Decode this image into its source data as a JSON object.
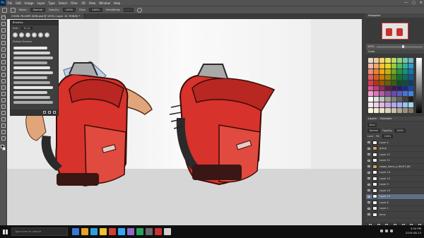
{
  "app": {
    "logo": "Ps",
    "menus": [
      "File",
      "Edit",
      "Image",
      "Layer",
      "Type",
      "Select",
      "Filter",
      "3D",
      "View",
      "Window",
      "Help"
    ],
    "window_controls": [
      "—",
      "▢",
      "✕"
    ]
  },
  "options_bar": {
    "mode_label": "Mode:",
    "mode_value": "Normal",
    "opacity_label": "Opacity:",
    "opacity_value": "100%",
    "flow_label": "Flow:",
    "flow_value": "100%",
    "smoothing_label": "Smoothing:"
  },
  "document_tab": {
    "title": "CHARL PALMER (WIN.psd @ 100% (Layer 10, RGB/8) *"
  },
  "brush_panel": {
    "title": "Brushes",
    "size_label": "Size:",
    "size_value": "10 px",
    "group_label": "Default Brushes",
    "stroke_count": 12
  },
  "right_panels": {
    "navigator_tab": "Navigator",
    "zoom_value": "100%",
    "color_tab": "Color",
    "layers_tab": "Layers",
    "channels_tab": "Channels",
    "kind_label": "Kind",
    "blend_mode": "Normal",
    "opacity_label": "Opacity:",
    "opacity_value": "100%",
    "lock_label": "Lock:",
    "fill_label": "Fill:",
    "fill_value": "100%",
    "layers": [
      {
        "name": "Layer 4",
        "group": false,
        "selected": false
      },
      {
        "name": "group",
        "group": true,
        "selected": false
      },
      {
        "name": "Layer 12",
        "group": false,
        "selected": false
      },
      {
        "name": "Layer 11",
        "group": false,
        "selected": false
      },
      {
        "name": "shape_items_a_RIGHT_BK",
        "group": true,
        "selected": false
      },
      {
        "name": "Layer 14",
        "group": false,
        "selected": false
      },
      {
        "name": "Layer 13",
        "group": false,
        "selected": false
      },
      {
        "name": "Layer 9",
        "group": false,
        "selected": false
      },
      {
        "name": "Layer 15",
        "group": false,
        "selected": false
      },
      {
        "name": "Layer 10",
        "group": false,
        "selected": true
      },
      {
        "name": "Layer 8",
        "group": false,
        "selected": false
      },
      {
        "name": "Layer 1",
        "group": false,
        "selected": false
      },
      {
        "name": "arms",
        "group": false,
        "selected": false
      }
    ]
  },
  "palette_colors": [
    "#e8d8c8",
    "#f0c9a0",
    "#f5d36b",
    "#e8e05a",
    "#b9d96a",
    "#8ad27f",
    "#6ec9a7",
    "#6bb6cf",
    "#f2b9a6",
    "#f1a66c",
    "#f7c431",
    "#e4d81d",
    "#99cc3a",
    "#4fbb5d",
    "#2fb29c",
    "#2f9ccf",
    "#ef8b7a",
    "#ee8131",
    "#f2a30d",
    "#c9b20a",
    "#6aa81e",
    "#21963f",
    "#12917e",
    "#1378b5",
    "#e85c5c",
    "#e0571a",
    "#cc7a00",
    "#9a8a00",
    "#4a8612",
    "#12722f",
    "#0b6e62",
    "#0d5a90",
    "#d83a57",
    "#b83210",
    "#965600",
    "#6b6000",
    "#336010",
    "#0d5022",
    "#084f47",
    "#09406a",
    "#e05a9a",
    "#c23a7c",
    "#8d2a5e",
    "#5c1c3f",
    "#3a1a55",
    "#261a6e",
    "#1a2a8a",
    "#1a45b0",
    "#f0a0c8",
    "#d978b8",
    "#b45aa4",
    "#8a4a9c",
    "#6a4aa8",
    "#5a5ac0",
    "#4a72d0",
    "#3a8ae0",
    "#ffffff",
    "#e0e0e0",
    "#c0c0c0",
    "#a0a0a0",
    "#808080",
    "#606060",
    "#404040",
    "#202020",
    "#f7e6f0",
    "#efd0e8",
    "#e0b8e0",
    "#c8a8e0",
    "#b0a8e8",
    "#a0b0f0",
    "#98c0f0",
    "#a0d8f0",
    "#fbf5e6",
    "#f5ecd6",
    "#ebe0c8",
    "#ddd2bc",
    "#c8bfae",
    "#b0a896",
    "#989080",
    "#807868"
  ],
  "taskbar": {
    "search_placeholder": "Type here to search",
    "time": "3:33 PM",
    "date": "2019-08-13",
    "apps": [
      "#3a78d8",
      "#e5a323",
      "#2aa0e0",
      "#f0c030",
      "#d04030",
      "#31a8ff",
      "#8a6ac8",
      "#2aa060",
      "#6a6a6a",
      "#cc3030",
      "#d0d0d0"
    ]
  }
}
